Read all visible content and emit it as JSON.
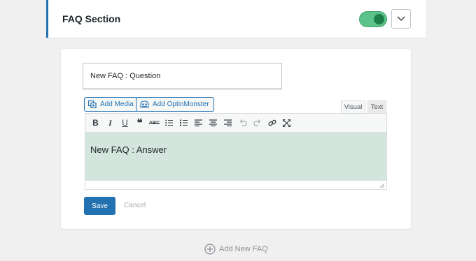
{
  "section": {
    "title": "FAQ Section",
    "toggle_on": true
  },
  "question": {
    "value": "New FAQ : Question"
  },
  "media_buttons": {
    "add_media": "Add Media",
    "add_optinmonster": "Add OptinMonster"
  },
  "editor_tabs": {
    "visual": "Visual",
    "text": "Text"
  },
  "toolbar": {
    "icons": [
      "bold-icon",
      "italic-icon",
      "underline-icon",
      "blockquote-icon",
      "strikethrough-icon",
      "bulleted-list-icon",
      "numbered-list-icon",
      "align-left-icon",
      "align-center-icon",
      "align-right-icon",
      "undo-icon",
      "redo-icon",
      "link-icon",
      "fullscreen-icon"
    ]
  },
  "answer": {
    "text": "New FAQ : Answer"
  },
  "actions": {
    "save": "Save",
    "cancel": "Cancel",
    "add_new": "Add New FAQ"
  },
  "colors": {
    "accent": "#2271b1",
    "toggle": "#5cc48a",
    "editor_bg": "#d4e5de"
  }
}
